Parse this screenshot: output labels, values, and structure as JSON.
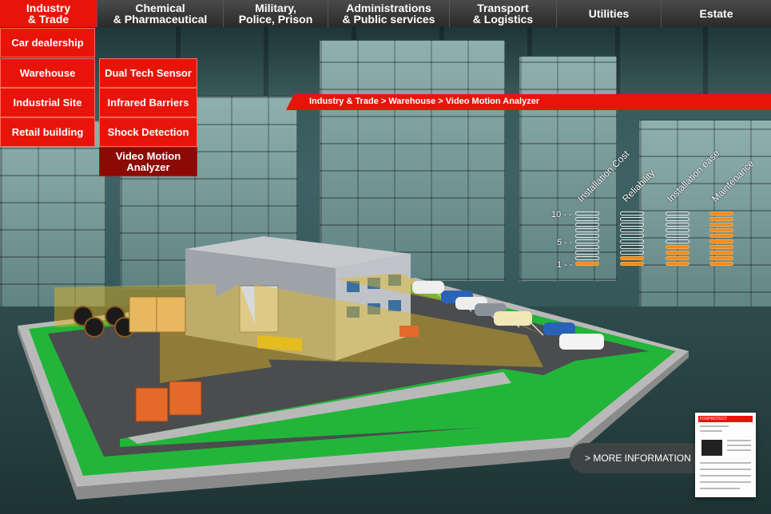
{
  "nav": {
    "tabs": [
      {
        "label": "Industry\n& Trade",
        "active": true
      },
      {
        "label": "Chemical\n& Pharmaceutical",
        "active": false
      },
      {
        "label": "Military,\nPolice, Prison",
        "active": false
      },
      {
        "label": "Administrations\n& Public services",
        "active": false
      },
      {
        "label": "Transport\n& Logistics",
        "active": false
      },
      {
        "label": "Utilities",
        "active": false
      },
      {
        "label": "Estate",
        "active": false
      }
    ]
  },
  "sites": {
    "items": [
      "Car dealership",
      "Warehouse",
      "Industrial Site",
      "Retail building"
    ]
  },
  "solutions": {
    "items": [
      "Dual Tech Sensor",
      "Infrared Barriers",
      "Shock Detection",
      "Video Motion\nAnalyzer"
    ]
  },
  "breadcrumb": {
    "text": "Industry & Trade > Warehouse >  Video Motion Analyzer"
  },
  "ratings": {
    "scale_labels": [
      "10 - -",
      "5 - -",
      "1 - -"
    ],
    "max": 10,
    "criteria": [
      {
        "label": "Installation Cost",
        "value": 1
      },
      {
        "label": "Reliability",
        "value": 2
      },
      {
        "label": "Installation ease",
        "value": 4
      },
      {
        "label": "Maintenance",
        "value": 10
      }
    ],
    "filled_color": "#f28a1a",
    "empty_color": "#e6e6e6"
  },
  "more_info": {
    "label": "> MORE INFORMATION"
  },
  "brochure": {
    "header": "FOXPROTECT"
  },
  "colors": {
    "accent": "#e8140a",
    "active_submenu": "#8c0a05",
    "grass": "#22b53a"
  }
}
